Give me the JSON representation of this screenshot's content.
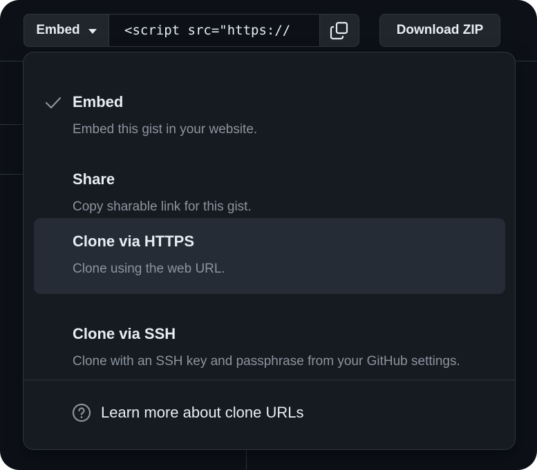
{
  "toolbar": {
    "embed_label": "Embed",
    "embed_value": "<script src=\"https://",
    "download_label": "Download ZIP"
  },
  "menu": {
    "items": [
      {
        "title": "Embed",
        "description": "Embed this gist in your website.",
        "selected": true
      },
      {
        "title": "Share",
        "description": "Copy sharable link for this gist.",
        "selected": false
      },
      {
        "title": "Clone via HTTPS",
        "description": "Clone using the web URL.",
        "selected": false
      },
      {
        "title": "Clone via SSH",
        "description": "Clone with an SSH key and passphrase from your GitHub settings.",
        "selected": false
      }
    ],
    "learn_more": "Learn more about clone URLs"
  },
  "colors": {
    "background": "#0d1117",
    "menu_bg": "#161b22",
    "hover_bg": "#262c36",
    "text": "#e6edf3",
    "muted": "#8b949e",
    "border": "#30363d"
  },
  "icons": [
    "copy-icon",
    "check-icon",
    "question-icon",
    "caret-down-icon"
  ]
}
